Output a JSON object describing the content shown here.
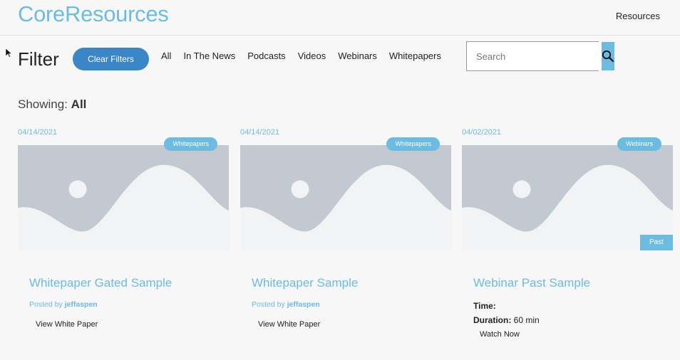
{
  "header": {
    "brand": "CoreResources",
    "nav_resources": "Resources"
  },
  "filter": {
    "title": "Filter",
    "clear_label": "Clear Filters",
    "links": [
      "All",
      "In The News",
      "Podcasts",
      "Videos",
      "Webinars",
      "Whitepapers"
    ],
    "search_placeholder": "Search"
  },
  "showing": {
    "label": "Showing:",
    "value": "All"
  },
  "cards": [
    {
      "date": "04/14/2021",
      "tag": "Whitepapers",
      "title": "Whitepaper Gated Sample",
      "posted_prefix": "Posted by",
      "author": "jeffaspen",
      "action": "View White Paper"
    },
    {
      "date": "04/14/2021",
      "tag": "Whitepapers",
      "title": "Whitepaper Sample",
      "posted_prefix": "Posted by",
      "author": "jeffaspen",
      "action": "View White Paper"
    },
    {
      "date": "04/02/2021",
      "tag": "Webinars",
      "badge": "Past",
      "title": "Webinar Past Sample",
      "time_label": "Time:",
      "duration_label": "Duration:",
      "duration_value": "60 min",
      "action": "Watch Now"
    }
  ],
  "colors": {
    "accent": "#6cbbe0",
    "button": "#3a86c6",
    "placeholder_image": "#c2c9d0"
  },
  "icons": {
    "search": "search-icon",
    "cursor": "cursor-icon",
    "image_placeholder": "image-placeholder-icon"
  }
}
